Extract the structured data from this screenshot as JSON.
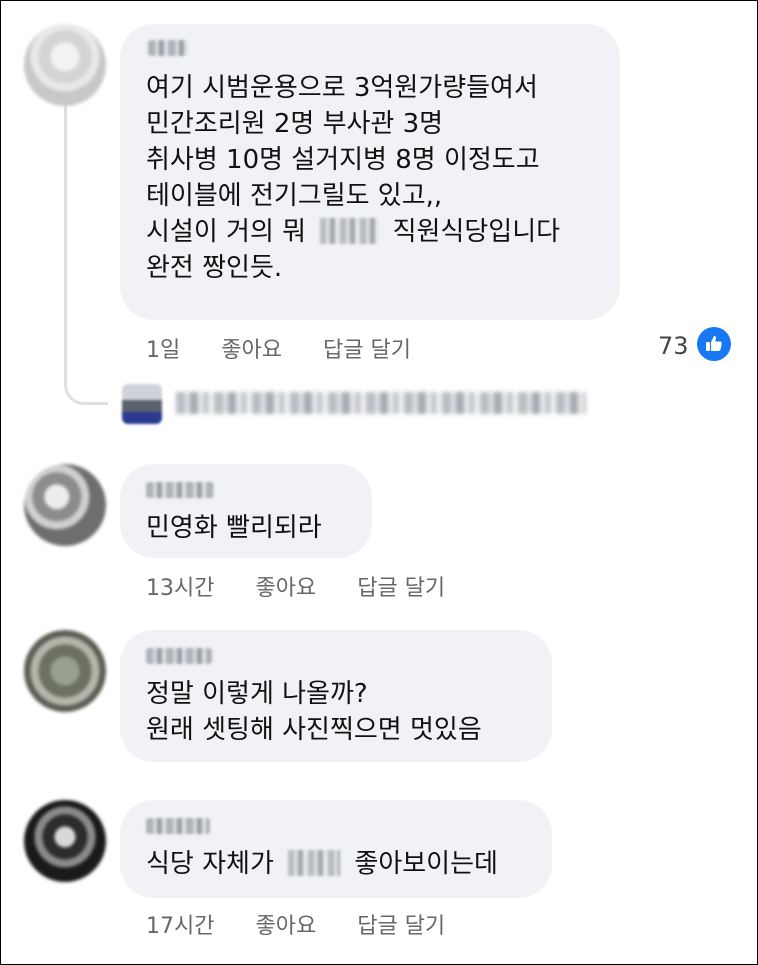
{
  "comments": [
    {
      "lines": [
        "여기 시범운용으로 3억원가량들여서",
        "민간조리원 2명 부사관 3명",
        "취사병 10명 설거지병 8명 이정도고",
        "테이블에 전기그릴도 있고,,"
      ],
      "line5_before": "시설이 거의 뭐",
      "line5_after": "직원식당입니다",
      "line6": "완전 짱인듯.",
      "time": "1일",
      "like": "좋아요",
      "reply": "답글 달기",
      "reaction_count": "73"
    },
    {
      "text": "민영화 빨리되라",
      "time": "13시간",
      "like": "좋아요",
      "reply": "답글 달기"
    },
    {
      "lines": [
        "정말 이렇게 나올까?",
        "원래 셋팅해 사진찍으면 멋있음"
      ]
    },
    {
      "before": "식당 자체가",
      "after": "좋아보이는데",
      "time": "17시간",
      "like": "좋아요",
      "reply": "답글 달기"
    }
  ],
  "colors": {
    "bubble": "#f0f2f5",
    "meta_text": "#65676b",
    "like_blue": "#1877f2"
  },
  "icons": [
    "thumbs-up-icon"
  ]
}
